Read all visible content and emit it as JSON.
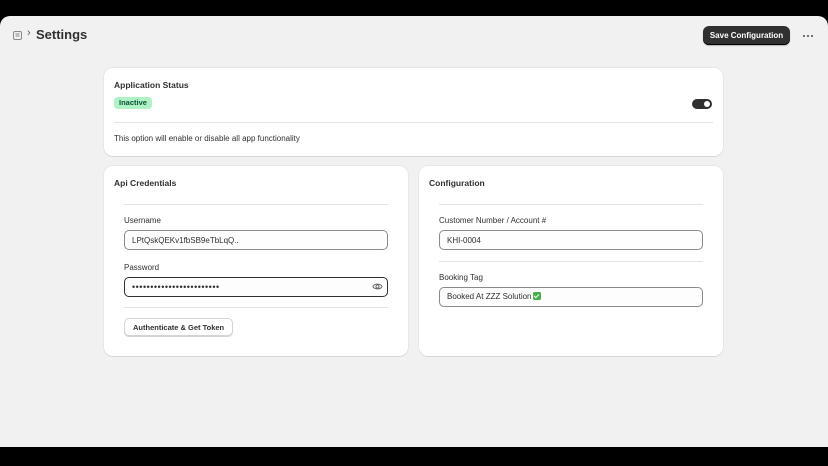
{
  "header": {
    "title": "Settings",
    "save_label": "Save Configuration"
  },
  "status_card": {
    "title": "Application Status",
    "badge": "Inactive",
    "toggle_on": true,
    "help_text": "This option will enable or disable all app functionality"
  },
  "api_card": {
    "title": "Api Credentials",
    "username_label": "Username",
    "username_value": "LPtQskQEKv1fbSB9eTbLqQ..",
    "password_label": "Password",
    "password_value": "••••••••••••••••••••••••",
    "auth_button": "Authenticate & Get Token"
  },
  "config_card": {
    "title": "Configuration",
    "customer_label": "Customer Number / Account #",
    "customer_value": "KHI-0004",
    "booking_label": "Booking Tag",
    "booking_value": "Booked At ZZZ Solution"
  },
  "colors": {
    "primary_button": "#303030",
    "badge_bg": "#aff2c5",
    "badge_text": "#0c5132",
    "check_emoji": "#47b04b"
  },
  "icons": [
    "app-icon",
    "chevron-right-icon",
    "more-horizontal-icon",
    "eye-icon",
    "check-mark-emoji-icon"
  ]
}
